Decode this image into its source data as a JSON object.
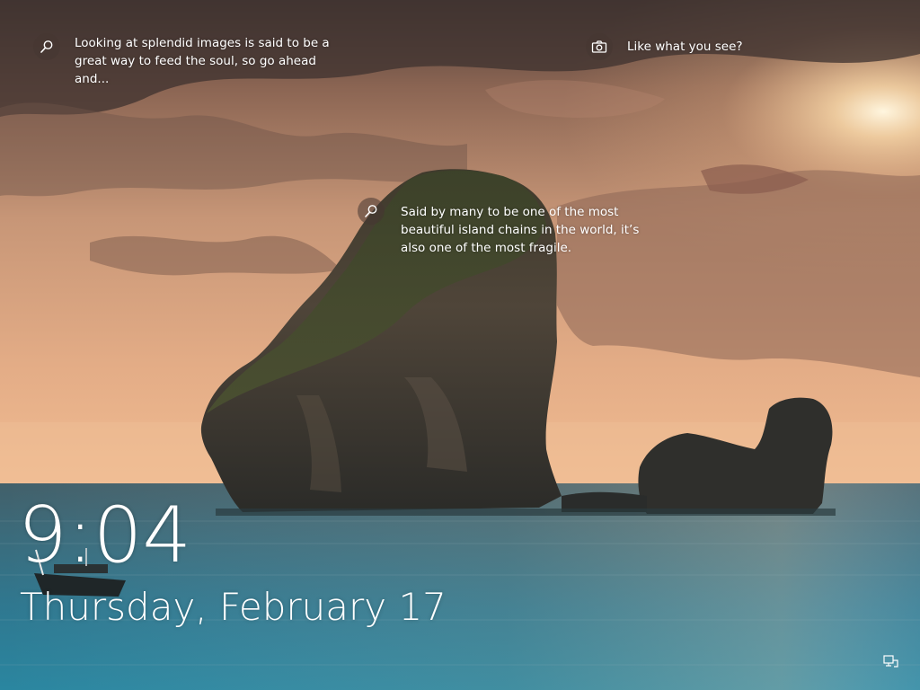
{
  "spotlight": {
    "tip_left": {
      "icon": "search-icon",
      "text": "Looking at splendid images is said to be a great way to feed the soul, so go ahead and..."
    },
    "tip_right": {
      "icon": "camera-icon",
      "text": "Like what you see?"
    },
    "tip_center": {
      "icon": "search-icon",
      "text": "Said by many to be one of the most beautiful island chains in the world, it’s also one of the most fragile."
    }
  },
  "lock": {
    "time": "9:04",
    "date": "Thursday, February 17"
  },
  "status": {
    "network_icon": "network-wired-icon"
  },
  "colors": {
    "sky_top": "#5f4a42",
    "sky_mid": "#c99a7d",
    "sky_low": "#e9b58d",
    "sun": "#fff3d6",
    "water_top": "#3d6a79",
    "water_bottom": "#2d7f95"
  }
}
